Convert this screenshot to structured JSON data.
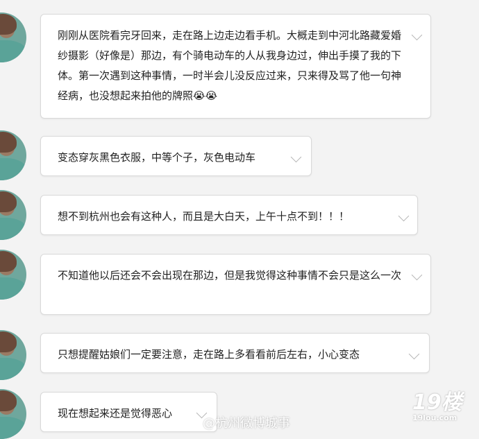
{
  "messages": [
    {
      "text": "刚刚从医院看完牙回来，走在路上边走边看手机。大概走到中河北路藏爱婚纱摄影（好像是）那边，有个骑电动车的人从我身边过，伸出手摸了我的下体。第一次遇到这种事情，一时半会儿没反应过来，只来得及骂了他一句神经病，也没想起来拍他的牌照😭😭"
    },
    {
      "text": "变态穿灰黑色衣服，中等个子，灰色电动车"
    },
    {
      "text": "想不到杭州也会有这种人，而且是大白天，上午十点不到！！！"
    },
    {
      "text": "不知道他以后还会不会出现在那边，但是我觉得这种事情不会只是这么一次"
    },
    {
      "text": "只想提醒姑娘们一定要注意，走在路上多看看前后左右，小心变态"
    },
    {
      "text": "现在想起来还是觉得恶心"
    }
  ],
  "watermarks": {
    "weibo": "@杭州微博城事",
    "site_big": "19楼",
    "site_small": "19lou.com"
  }
}
